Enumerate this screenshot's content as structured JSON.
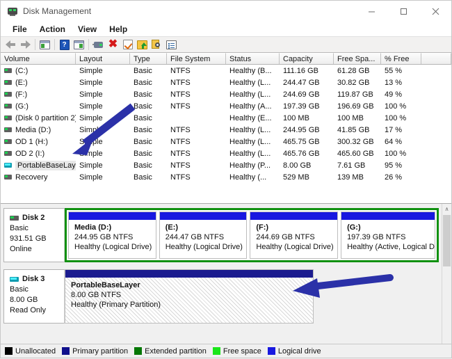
{
  "window": {
    "title": "Disk Management",
    "app_icon": "disk-management-icon",
    "minimize_label": "─",
    "maximize_label": "□",
    "close_label": "✕"
  },
  "menubar": {
    "items": [
      {
        "label": "File",
        "name": "menu-file"
      },
      {
        "label": "Action",
        "name": "menu-action"
      },
      {
        "label": "View",
        "name": "menu-view"
      },
      {
        "label": "Help",
        "name": "menu-help"
      }
    ]
  },
  "toolbar": {
    "buttons": [
      {
        "name": "back-button",
        "icon": "arrow-left-icon",
        "label": "Back"
      },
      {
        "name": "forward-button",
        "icon": "arrow-right-icon",
        "label": "Forward"
      },
      {
        "name": "show-hide-console-tree-button",
        "icon": "console-tree-icon",
        "label": "Show/Hide Console Tree"
      },
      {
        "name": "help-button",
        "icon": "help-question-icon",
        "label": "Help"
      },
      {
        "name": "show-hide-action-pane-button",
        "icon": "action-pane-icon",
        "label": "Show/Hide Action Pane"
      },
      {
        "name": "rescan-disks-button",
        "icon": "disk-icon",
        "label": "Rescan Disks"
      },
      {
        "name": "delete-button",
        "icon": "red-x-icon",
        "label": "Delete"
      },
      {
        "name": "check-button",
        "icon": "checkmark-icon",
        "label": "Check"
      },
      {
        "name": "extend-volume-button",
        "icon": "folder-up-icon",
        "label": "Extend Volume"
      },
      {
        "name": "examine-button",
        "icon": "magnifier-icon",
        "label": "Examine"
      },
      {
        "name": "properties-button",
        "icon": "properties-icon",
        "label": "Properties"
      }
    ]
  },
  "volume_list": {
    "columns": [
      {
        "label": "Volume",
        "width": 108
      },
      {
        "label": "Layout",
        "width": 78
      },
      {
        "label": "Type",
        "width": 53
      },
      {
        "label": "File System",
        "width": 85
      },
      {
        "label": "Status",
        "width": 77
      },
      {
        "label": "Capacity",
        "width": 78
      },
      {
        "label": "Free Spa...",
        "width": 68
      },
      {
        "label": "% Free",
        "width": 58
      },
      {
        "label": "",
        "width": 45
      }
    ],
    "rows": [
      {
        "volume": "(C:)",
        "icon": "drive-icon",
        "selected": false,
        "layout": "Simple",
        "type": "Basic",
        "file_system": "NTFS",
        "status": "Healthy (B...",
        "capacity": "111.16 GB",
        "free_space": "61.28 GB",
        "percent_free": "55 %"
      },
      {
        "volume": "(E:)",
        "icon": "drive-icon",
        "selected": false,
        "layout": "Simple",
        "type": "Basic",
        "file_system": "NTFS",
        "status": "Healthy (L...",
        "capacity": "244.47 GB",
        "free_space": "30.82 GB",
        "percent_free": "13 %"
      },
      {
        "volume": "(F:)",
        "icon": "drive-icon",
        "selected": false,
        "layout": "Simple",
        "type": "Basic",
        "file_system": "NTFS",
        "status": "Healthy (L...",
        "capacity": "244.69 GB",
        "free_space": "119.87 GB",
        "percent_free": "49 %"
      },
      {
        "volume": "(G:)",
        "icon": "drive-icon",
        "selected": false,
        "layout": "Simple",
        "type": "Basic",
        "file_system": "NTFS",
        "status": "Healthy (A...",
        "capacity": "197.39 GB",
        "free_space": "196.69 GB",
        "percent_free": "100 %"
      },
      {
        "volume": "(Disk 0 partition 2)",
        "icon": "drive-icon",
        "selected": false,
        "layout": "Simple",
        "type": "Basic",
        "file_system": "",
        "status": "Healthy (E...",
        "capacity": "100 MB",
        "free_space": "100 MB",
        "percent_free": "100 %"
      },
      {
        "volume": "Media (D:)",
        "icon": "drive-icon",
        "selected": false,
        "layout": "Simple",
        "type": "Basic",
        "file_system": "NTFS",
        "status": "Healthy (L...",
        "capacity": "244.95 GB",
        "free_space": "41.85 GB",
        "percent_free": "17 %"
      },
      {
        "volume": "OD 1 (H:)",
        "icon": "drive-icon",
        "selected": false,
        "layout": "Simple",
        "type": "Basic",
        "file_system": "NTFS",
        "status": "Healthy (L...",
        "capacity": "465.75 GB",
        "free_space": "300.32 GB",
        "percent_free": "64 %"
      },
      {
        "volume": "OD 2 (I:)",
        "icon": "drive-icon",
        "selected": false,
        "layout": "Simple",
        "type": "Basic",
        "file_system": "NTFS",
        "status": "Healthy (L...",
        "capacity": "465.76 GB",
        "free_space": "465.60 GB",
        "percent_free": "100 %"
      },
      {
        "volume": "PortableBaseLayer",
        "icon": "portable-base-layer-icon",
        "selected": true,
        "layout": "Simple",
        "type": "Basic",
        "file_system": "NTFS",
        "status": "Healthy (P...",
        "capacity": "8.00 GB",
        "free_space": "7.61 GB",
        "percent_free": "95 %"
      },
      {
        "volume": "Recovery",
        "icon": "drive-icon",
        "selected": false,
        "layout": "Simple",
        "type": "Basic",
        "file_system": "NTFS",
        "status": "Healthy (...",
        "capacity": "529 MB",
        "free_space": "139 MB",
        "percent_free": "26 %"
      }
    ]
  },
  "disks": [
    {
      "name": "Disk 2",
      "icon": "disk-icon",
      "type": "Basic",
      "size": "931.51 GB",
      "state": "Online",
      "container": "extended-partition",
      "volumes": [
        {
          "name": "Media  (D:)",
          "size_fs": "244.95 GB NTFS",
          "status": "Healthy (Logical Drive)",
          "kind": "logical-drive"
        },
        {
          "name": "(E:)",
          "size_fs": "244.47 GB NTFS",
          "status": "Healthy (Logical Drive)",
          "kind": "logical-drive"
        },
        {
          "name": "(F:)",
          "size_fs": "244.69 GB NTFS",
          "status": "Healthy (Logical Drive)",
          "kind": "logical-drive"
        },
        {
          "name": "(G:)",
          "size_fs": "197.39 GB NTFS",
          "status": "Healthy (Active, Logical D",
          "kind": "logical-drive"
        }
      ]
    },
    {
      "name": "Disk 3",
      "icon": "portable-base-layer-icon",
      "type": "Basic",
      "size": "8.00 GB",
      "state": "Read Only",
      "container": "primary-partition",
      "volumes": [
        {
          "name": "PortableBaseLayer",
          "size_fs": "8.00 GB NTFS",
          "status": "Healthy (Primary Partition)",
          "kind": "primary-partition"
        }
      ]
    }
  ],
  "scrollbar": {
    "up_arrow": "∧",
    "down_arrow": "∨"
  },
  "legend": {
    "items": [
      {
        "label": "Unallocated",
        "color": "#000000"
      },
      {
        "label": "Primary partition",
        "color": "#10108c"
      },
      {
        "label": "Extended partition",
        "color": "#067806"
      },
      {
        "label": "Free space",
        "color": "#19e619"
      },
      {
        "label": "Logical drive",
        "color": "#1818e0"
      }
    ]
  },
  "annotations": {
    "arrow_color": "#2b31a8",
    "arrows": [
      {
        "name": "annotation-arrow-volume-list",
        "points_to": "PortableBaseLayer row in volume list"
      },
      {
        "name": "annotation-arrow-disk3",
        "points_to": "PortableBaseLayer partition on Disk 3"
      }
    ]
  }
}
